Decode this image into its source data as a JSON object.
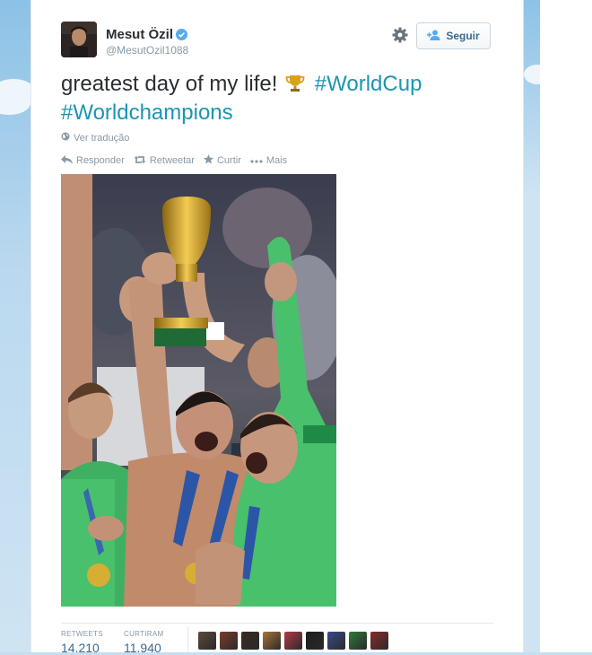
{
  "tweet": {
    "fullname": "Mesut Özil",
    "username": "@MesutOzil1088",
    "text_plain": "greatest day of my life!",
    "hashtags": [
      "#WorldCup",
      "#Worldchampions"
    ],
    "translate_label": "Ver tradução",
    "follow_label": "Seguir"
  },
  "actions": {
    "reply": "Responder",
    "retweet": "Retweetar",
    "like": "Curtir",
    "more": "Mais"
  },
  "stats": {
    "retweets_label": "RETWEETS",
    "retweets_value": "14.210",
    "likes_label": "CURTIRAM",
    "likes_value": "11.940"
  },
  "colors": {
    "link": "#1b95b0",
    "text": "#292f33",
    "muted": "#8899a6",
    "verified": "#55acee"
  },
  "likers": [
    {
      "icon": "liker-avatar-1",
      "color": "#5a4a3a"
    },
    {
      "icon": "liker-avatar-2",
      "color": "#7a3c2c"
    },
    {
      "icon": "liker-avatar-3",
      "color": "#3a2a22"
    },
    {
      "icon": "liker-avatar-4",
      "color": "#a8743c"
    },
    {
      "icon": "liker-avatar-5",
      "color": "#b23a4a"
    },
    {
      "icon": "liker-avatar-6",
      "color": "#1d1d1d"
    },
    {
      "icon": "liker-avatar-7",
      "color": "#3b4a8a"
    },
    {
      "icon": "liker-avatar-8",
      "color": "#2f7a3a"
    },
    {
      "icon": "liker-avatar-9",
      "color": "#8a2a2a"
    }
  ]
}
